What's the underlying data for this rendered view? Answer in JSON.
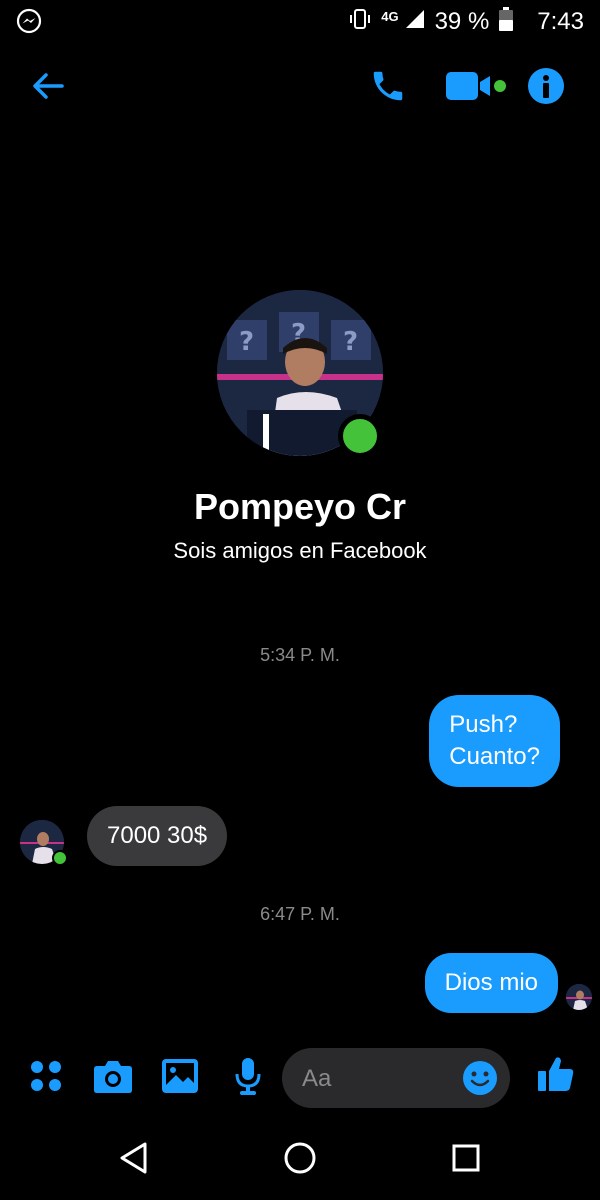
{
  "status_bar": {
    "app_icon": "messenger-icon",
    "network": "4G",
    "battery": "39 %",
    "time": "7:43"
  },
  "header": {
    "back_icon": "arrow-left-icon",
    "call_icon": "phone-icon",
    "video_icon": "video-camera-icon",
    "info_icon": "info-icon"
  },
  "profile": {
    "name": "Pompeyo Cr",
    "subtitle": "Sois amigos en Facebook"
  },
  "messages": [
    {
      "type": "timestamp",
      "text": "5:34 P. M."
    },
    {
      "type": "outgoing",
      "lines": [
        "Push?",
        "Cuanto?"
      ]
    },
    {
      "type": "incoming",
      "text": "7000 30$"
    },
    {
      "type": "timestamp",
      "text": "6:47 P. M."
    },
    {
      "type": "outgoing",
      "text": "Dios mio"
    }
  ],
  "composer": {
    "placeholder": "Aa"
  },
  "colors": {
    "accent": "#1a9cff",
    "online": "#44c23a",
    "incoming_bubble": "#3a3a3c"
  }
}
